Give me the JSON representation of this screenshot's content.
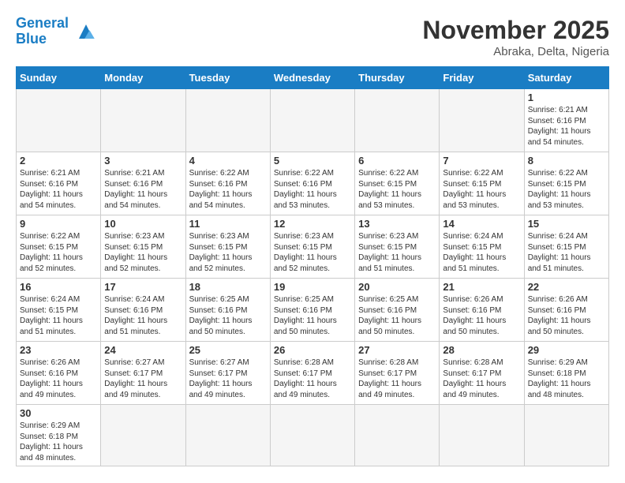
{
  "header": {
    "logo_line1": "General",
    "logo_line2": "Blue",
    "month_title": "November 2025",
    "subtitle": "Abraka, Delta, Nigeria"
  },
  "days_of_week": [
    "Sunday",
    "Monday",
    "Tuesday",
    "Wednesday",
    "Thursday",
    "Friday",
    "Saturday"
  ],
  "weeks": [
    [
      {
        "day": "",
        "info": ""
      },
      {
        "day": "",
        "info": ""
      },
      {
        "day": "",
        "info": ""
      },
      {
        "day": "",
        "info": ""
      },
      {
        "day": "",
        "info": ""
      },
      {
        "day": "",
        "info": ""
      },
      {
        "day": "1",
        "info": "Sunrise: 6:21 AM\nSunset: 6:16 PM\nDaylight: 11 hours\nand 54 minutes."
      }
    ],
    [
      {
        "day": "2",
        "info": "Sunrise: 6:21 AM\nSunset: 6:16 PM\nDaylight: 11 hours\nand 54 minutes."
      },
      {
        "day": "3",
        "info": "Sunrise: 6:21 AM\nSunset: 6:16 PM\nDaylight: 11 hours\nand 54 minutes."
      },
      {
        "day": "4",
        "info": "Sunrise: 6:22 AM\nSunset: 6:16 PM\nDaylight: 11 hours\nand 54 minutes."
      },
      {
        "day": "5",
        "info": "Sunrise: 6:22 AM\nSunset: 6:16 PM\nDaylight: 11 hours\nand 53 minutes."
      },
      {
        "day": "6",
        "info": "Sunrise: 6:22 AM\nSunset: 6:15 PM\nDaylight: 11 hours\nand 53 minutes."
      },
      {
        "day": "7",
        "info": "Sunrise: 6:22 AM\nSunset: 6:15 PM\nDaylight: 11 hours\nand 53 minutes."
      },
      {
        "day": "8",
        "info": "Sunrise: 6:22 AM\nSunset: 6:15 PM\nDaylight: 11 hours\nand 53 minutes."
      }
    ],
    [
      {
        "day": "9",
        "info": "Sunrise: 6:22 AM\nSunset: 6:15 PM\nDaylight: 11 hours\nand 52 minutes."
      },
      {
        "day": "10",
        "info": "Sunrise: 6:23 AM\nSunset: 6:15 PM\nDaylight: 11 hours\nand 52 minutes."
      },
      {
        "day": "11",
        "info": "Sunrise: 6:23 AM\nSunset: 6:15 PM\nDaylight: 11 hours\nand 52 minutes."
      },
      {
        "day": "12",
        "info": "Sunrise: 6:23 AM\nSunset: 6:15 PM\nDaylight: 11 hours\nand 52 minutes."
      },
      {
        "day": "13",
        "info": "Sunrise: 6:23 AM\nSunset: 6:15 PM\nDaylight: 11 hours\nand 51 minutes."
      },
      {
        "day": "14",
        "info": "Sunrise: 6:24 AM\nSunset: 6:15 PM\nDaylight: 11 hours\nand 51 minutes."
      },
      {
        "day": "15",
        "info": "Sunrise: 6:24 AM\nSunset: 6:15 PM\nDaylight: 11 hours\nand 51 minutes."
      }
    ],
    [
      {
        "day": "16",
        "info": "Sunrise: 6:24 AM\nSunset: 6:15 PM\nDaylight: 11 hours\nand 51 minutes."
      },
      {
        "day": "17",
        "info": "Sunrise: 6:24 AM\nSunset: 6:16 PM\nDaylight: 11 hours\nand 51 minutes."
      },
      {
        "day": "18",
        "info": "Sunrise: 6:25 AM\nSunset: 6:16 PM\nDaylight: 11 hours\nand 50 minutes."
      },
      {
        "day": "19",
        "info": "Sunrise: 6:25 AM\nSunset: 6:16 PM\nDaylight: 11 hours\nand 50 minutes."
      },
      {
        "day": "20",
        "info": "Sunrise: 6:25 AM\nSunset: 6:16 PM\nDaylight: 11 hours\nand 50 minutes."
      },
      {
        "day": "21",
        "info": "Sunrise: 6:26 AM\nSunset: 6:16 PM\nDaylight: 11 hours\nand 50 minutes."
      },
      {
        "day": "22",
        "info": "Sunrise: 6:26 AM\nSunset: 6:16 PM\nDaylight: 11 hours\nand 50 minutes."
      }
    ],
    [
      {
        "day": "23",
        "info": "Sunrise: 6:26 AM\nSunset: 6:16 PM\nDaylight: 11 hours\nand 49 minutes."
      },
      {
        "day": "24",
        "info": "Sunrise: 6:27 AM\nSunset: 6:17 PM\nDaylight: 11 hours\nand 49 minutes."
      },
      {
        "day": "25",
        "info": "Sunrise: 6:27 AM\nSunset: 6:17 PM\nDaylight: 11 hours\nand 49 minutes."
      },
      {
        "day": "26",
        "info": "Sunrise: 6:28 AM\nSunset: 6:17 PM\nDaylight: 11 hours\nand 49 minutes."
      },
      {
        "day": "27",
        "info": "Sunrise: 6:28 AM\nSunset: 6:17 PM\nDaylight: 11 hours\nand 49 minutes."
      },
      {
        "day": "28",
        "info": "Sunrise: 6:28 AM\nSunset: 6:17 PM\nDaylight: 11 hours\nand 49 minutes."
      },
      {
        "day": "29",
        "info": "Sunrise: 6:29 AM\nSunset: 6:18 PM\nDaylight: 11 hours\nand 48 minutes."
      }
    ],
    [
      {
        "day": "30",
        "info": "Sunrise: 6:29 AM\nSunset: 6:18 PM\nDaylight: 11 hours\nand 48 minutes."
      },
      {
        "day": "",
        "info": ""
      },
      {
        "day": "",
        "info": ""
      },
      {
        "day": "",
        "info": ""
      },
      {
        "day": "",
        "info": ""
      },
      {
        "day": "",
        "info": ""
      },
      {
        "day": "",
        "info": ""
      }
    ]
  ]
}
